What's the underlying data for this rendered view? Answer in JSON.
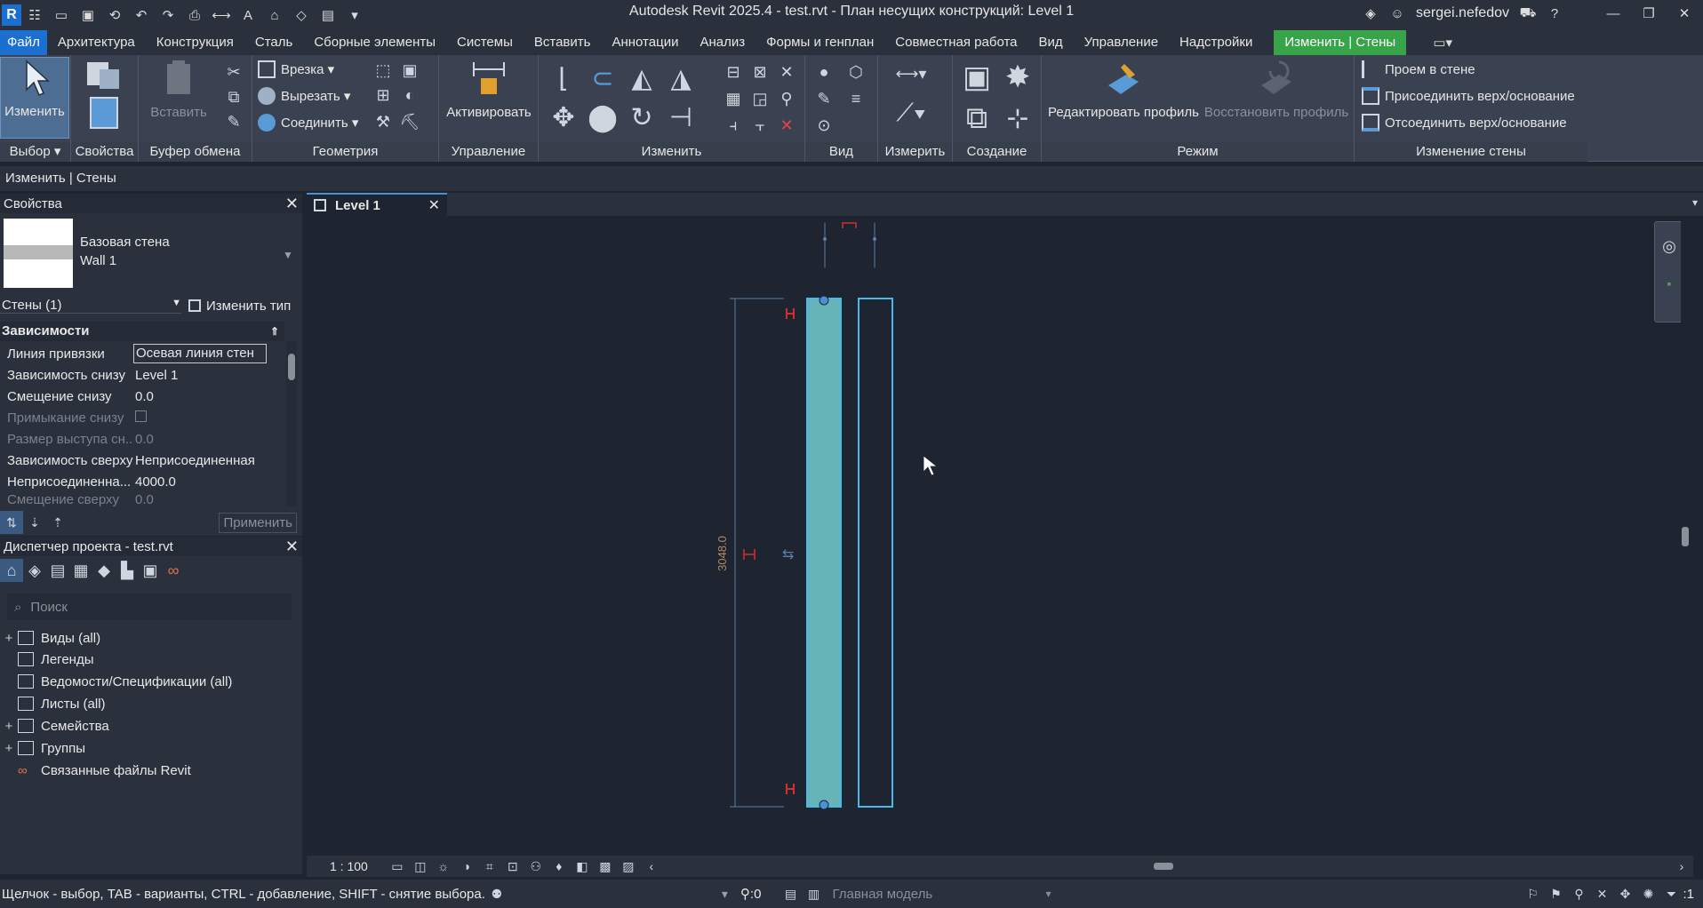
{
  "titlebar": {
    "title": "Autodesk Revit 2025.4 - test.rvt - План несущих конструкций: Level 1",
    "user": "sergei.nefedov"
  },
  "menu": {
    "tabs": [
      {
        "label": "Файл"
      },
      {
        "label": "Архитектура"
      },
      {
        "label": "Конструкция"
      },
      {
        "label": "Сталь"
      },
      {
        "label": "Сборные элементы"
      },
      {
        "label": "Системы"
      },
      {
        "label": "Вставить"
      },
      {
        "label": "Аннотации"
      },
      {
        "label": "Анализ"
      },
      {
        "label": "Формы и генплан"
      },
      {
        "label": "Совместная работа"
      },
      {
        "label": "Вид"
      },
      {
        "label": "Управление"
      },
      {
        "label": "Надстройки"
      },
      {
        "label": "Изменить | Стены"
      }
    ]
  },
  "ribbon": {
    "modify_label": "Изменить",
    "properties_label": "",
    "paste_label": "Вставить",
    "cope_label": "Врезка",
    "cut_label": "Вырезать",
    "join_label": "Соединить",
    "activate_label": "Активировать",
    "edit_profile_label": "Редактировать профиль",
    "reset_profile_label": "Восстановить профиль",
    "wall_opening_label": "Проем в стене",
    "attach_label": "Присоединить верх/основание",
    "detach_label": "Отсоединить верх/основание",
    "panels": {
      "select": "Выбор",
      "properties": "Свойства",
      "clipboard": "Буфер обмена",
      "geometry": "Геометрия",
      "control": "Управление",
      "modify": "Изменить",
      "view": "Вид",
      "measure": "Измерить",
      "create": "Создание",
      "mode": "Режим",
      "modify_wall": "Изменение стены"
    }
  },
  "context_bar": "Изменить | Стены",
  "properties": {
    "title": "Свойства",
    "type_family": "Базовая стена",
    "type_name": "Wall 1",
    "filter": "Стены (1)",
    "edit_type": "Изменить тип",
    "group": "Зависимости",
    "rows": [
      {
        "key": "Линия привязки",
        "value": "Осевая линия стен"
      },
      {
        "key": "Зависимость снизу",
        "value": "Level 1"
      },
      {
        "key": "Смещение снизу",
        "value": "0.0"
      },
      {
        "key": "Примыкание снизу",
        "value": ""
      },
      {
        "key": "Размер выступа сн...",
        "value": "0.0"
      },
      {
        "key": "Зависимость сверху",
        "value": "Неприсоединенная"
      },
      {
        "key": "Неприсоединенна...",
        "value": "4000.0"
      },
      {
        "key": "Смещение сверху",
        "value": "0.0"
      }
    ],
    "apply": "Применить"
  },
  "browser": {
    "title": "Диспетчер проекта - test.rvt",
    "search_placeholder": "Поиск",
    "items": [
      {
        "label": "Виды (all)"
      },
      {
        "label": "Легенды"
      },
      {
        "label": "Ведомости/Спецификации (all)"
      },
      {
        "label": "Листы (all)"
      },
      {
        "label": "Семейства"
      },
      {
        "label": "Группы"
      },
      {
        "label": "Связанные файлы Revit"
      }
    ]
  },
  "view": {
    "tab_label": "Level 1",
    "dimension_text": "3048.0",
    "scale": "1 : 100"
  },
  "status": {
    "hint": "Щелчок - выбор, TAB - варианты, CTRL - добавление, SHIFT - снятие выбора.",
    "worksets": ":0",
    "model": "Главная модель",
    "filter_count": ":1"
  }
}
